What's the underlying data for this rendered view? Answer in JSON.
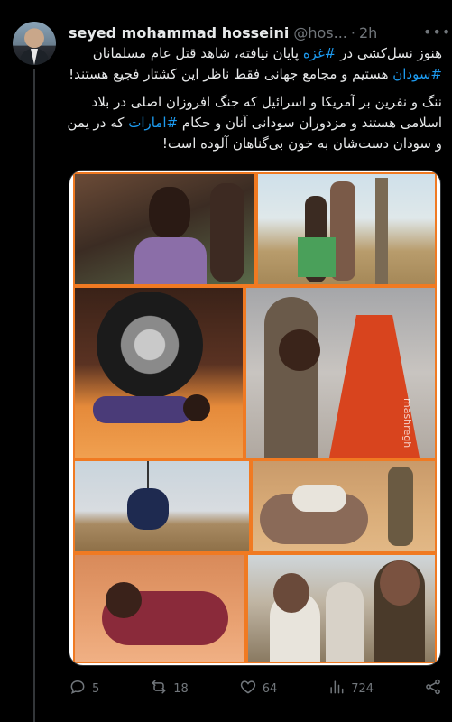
{
  "author": {
    "name": "seyed mohammad hosseini",
    "handle": "@hos...",
    "separator": "·",
    "time": "2h"
  },
  "tweet": {
    "paragraph1": [
      {
        "text": "هنوز نسل‌کشی در ",
        "tag": false
      },
      {
        "text": "#غزه",
        "tag": true
      },
      {
        "text": " پایان نیافته، شاهد قتل عام مسلمانان ",
        "tag": false
      },
      {
        "text": "#سودان",
        "tag": true
      },
      {
        "text": " هستیم و مجامع جهانی فقط ناظر این کشتار فجیع هستند!",
        "tag": false
      }
    ],
    "paragraph2": [
      {
        "text": "ننگ و نفرین بر آمریکا و اسرائیل که جنگ افروزان اصلی در بلاد اسلامی هستند و مزدوران سودانی آنان و حکام ",
        "tag": false
      },
      {
        "text": "#امارات",
        "tag": true
      },
      {
        "text": " که در یمن و سودان دست‌شان به خون بی‌گناهان آلوده است!",
        "tag": false
      }
    ]
  },
  "media": {
    "watermark": "mashregh"
  },
  "actions": {
    "replies": "5",
    "reposts": "18",
    "likes": "64",
    "views": "724"
  },
  "icons": [
    "reply-icon",
    "repost-icon",
    "like-icon",
    "views-icon",
    "share-icon",
    "more-icon"
  ],
  "colors": {
    "background": "#000000",
    "text": "#e7e9ea",
    "muted": "#71767b",
    "link": "#1d9bf0",
    "collage_border": "#f07a22"
  }
}
